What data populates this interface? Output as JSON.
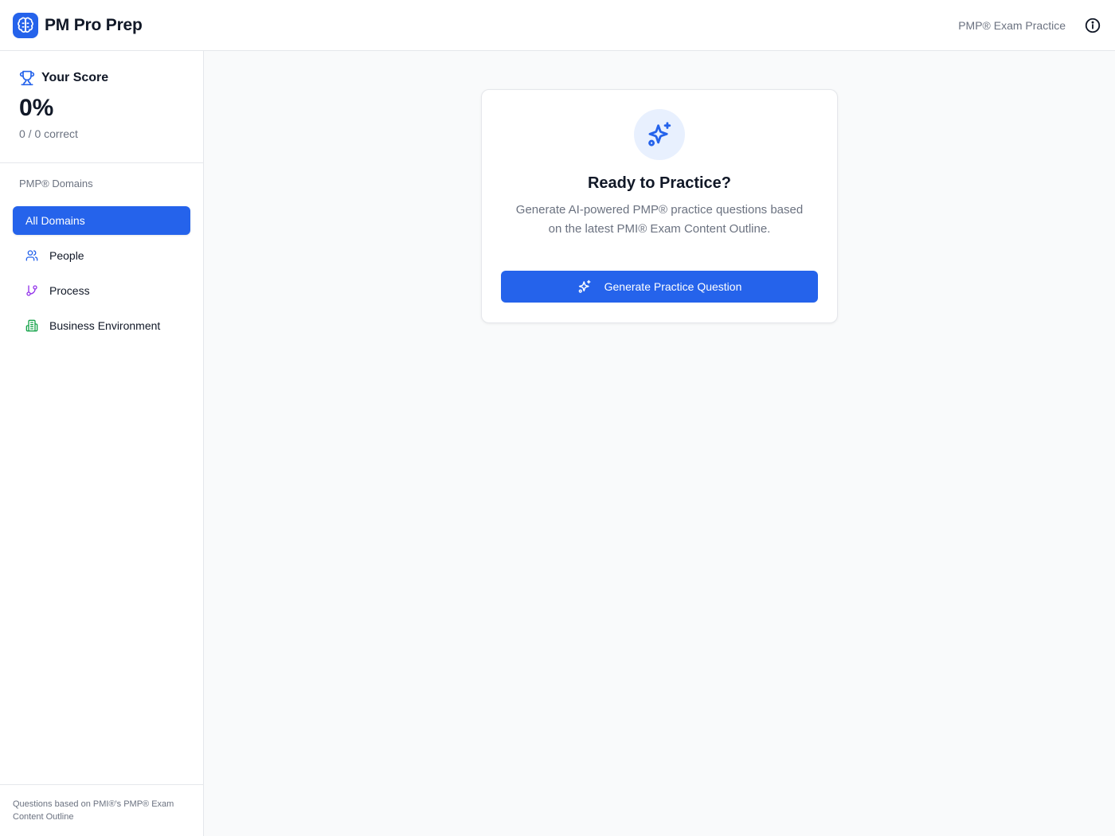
{
  "app": {
    "title": "PM Pro Prep",
    "subtitle": "PMP® Exam Practice",
    "logo_icon": "brain-icon",
    "accent_color": "#2563eb"
  },
  "score": {
    "title": "Your Score",
    "icon": "trophy-icon",
    "percent": "0%",
    "detail": "0 / 0 correct"
  },
  "sidebar": {
    "domains_label": "PMP® Domains",
    "items": [
      {
        "label": "All Domains",
        "icon": "none",
        "active": true
      },
      {
        "label": "People",
        "icon": "users-icon",
        "icon_color": "#2563eb"
      },
      {
        "label": "Process",
        "icon": "git-branch-icon",
        "icon_color": "#9333ea"
      },
      {
        "label": "Business Environment",
        "icon": "building-icon",
        "icon_color": "#16a34a"
      }
    ],
    "footer": "Questions based on PMI®'s PMP® Exam Content Outline"
  },
  "main": {
    "card": {
      "icon": "sparkles-icon",
      "title": "Ready to Practice?",
      "description": "Generate AI-powered PMP® practice questions based on the latest PMI® Exam Content Outline.",
      "button_label": "Generate Practice Question",
      "button_icon": "sparkles-icon"
    }
  }
}
